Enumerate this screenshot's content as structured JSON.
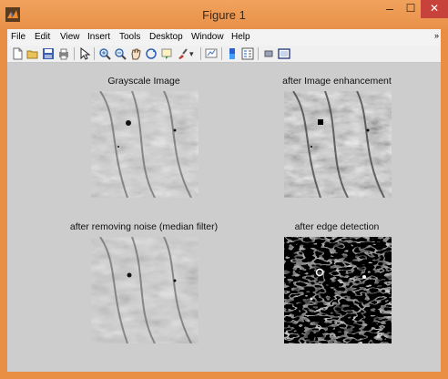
{
  "window": {
    "title": "Figure 1"
  },
  "menu": {
    "items": [
      "File",
      "Edit",
      "View",
      "Insert",
      "Tools",
      "Desktop",
      "Window",
      "Help"
    ],
    "overflow": "»"
  },
  "toolbar": {
    "icons": [
      "new-figure-icon",
      "open-file-icon",
      "save-icon",
      "print-icon",
      "pointer-icon",
      "zoom-in-icon",
      "zoom-out-icon",
      "pan-icon",
      "rotate-3d-icon",
      "data-cursor-icon",
      "brush-icon",
      "dropdown-icon",
      "link-plot-icon",
      "insert-colorbar-icon",
      "insert-legend-icon",
      "hide-plot-tools-icon",
      "show-plot-tools-icon"
    ]
  },
  "axes": [
    {
      "title": "Grayscale Image",
      "style": "gray"
    },
    {
      "title": "after Image enhancement",
      "style": "enhanced"
    },
    {
      "title": "after removing noise (median filter)",
      "style": "median"
    },
    {
      "title": "after edge detection",
      "style": "edges"
    }
  ],
  "colors": {
    "titlebar": "#e9914a",
    "close": "#c7423a",
    "canvas": "#cdcdcd"
  }
}
